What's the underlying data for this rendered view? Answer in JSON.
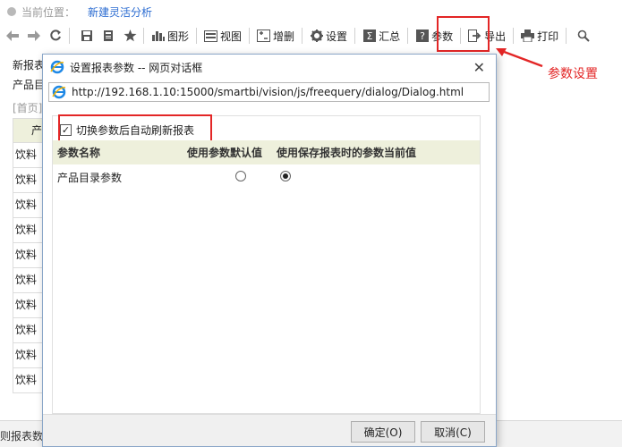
{
  "breadcrumb": {
    "label": "当前位置：",
    "current": "新建灵活分析"
  },
  "toolbar": {
    "chart_label": "图形",
    "view_label": "视图",
    "addremove_label": "增删",
    "settings_label": "设置",
    "sum_label": "汇总",
    "params_label": "参数",
    "export_label": "导出",
    "print_label": "打印"
  },
  "annotation": {
    "text": "参数设置"
  },
  "background": {
    "line1": "新报表",
    "line2": "产品目",
    "line3": "[首页]",
    "header": "产",
    "cell": "饮料",
    "rows": 10,
    "status": "则报表数"
  },
  "dialog": {
    "title": "设置报表参数 -- 网页对话框",
    "url": "http://192.168.1.10:15000/smartbi/vision/js/freequery/dialog/Dialog.html",
    "checkbox_label": "切换参数后自动刷新报表",
    "checkbox_checked": true,
    "columns": [
      "参数名称",
      "使用参数默认值",
      "使用保存报表时的参数当前值"
    ],
    "rows": [
      {
        "name": "产品目录参数",
        "use_default": false,
        "use_saved": true
      }
    ],
    "ok_label": "确定(O)",
    "cancel_label": "取消(C)"
  },
  "colors": {
    "accent": "#2a6bd1",
    "highlight": "#e32626",
    "header_bg": "#eef0dc"
  }
}
